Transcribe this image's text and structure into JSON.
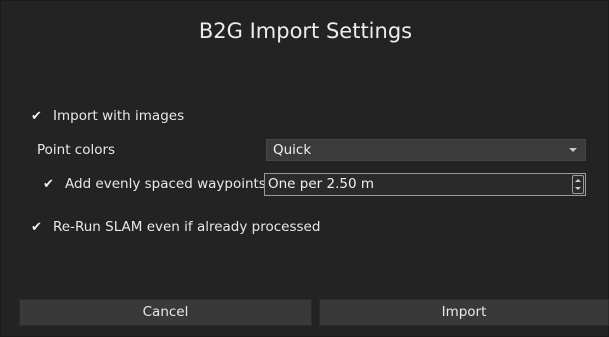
{
  "dialog": {
    "title": "B2G Import Settings"
  },
  "options": {
    "import_with_images": {
      "checkmark": "✔",
      "label": "Import with images",
      "checked": true
    },
    "point_colors": {
      "label": "Point colors",
      "selected": "Quick"
    },
    "waypoints": {
      "checkmark": "✔",
      "label": "Add evenly spaced waypoints",
      "checked": true,
      "value": "One per 2.50 m"
    },
    "rerun_slam": {
      "checkmark": "✔",
      "label": "Re-Run SLAM even if already processed",
      "checked": true
    }
  },
  "buttons": {
    "cancel": "Cancel",
    "import": "Import"
  },
  "icons": {
    "combo_arrow": "chevron-down-icon",
    "spin_up": "chevron-up-icon",
    "spin_down": "chevron-down-icon"
  },
  "colors": {
    "background": "#232323",
    "control": "#3b3b3b",
    "button": "#393939",
    "text": "#e8e8e8"
  }
}
